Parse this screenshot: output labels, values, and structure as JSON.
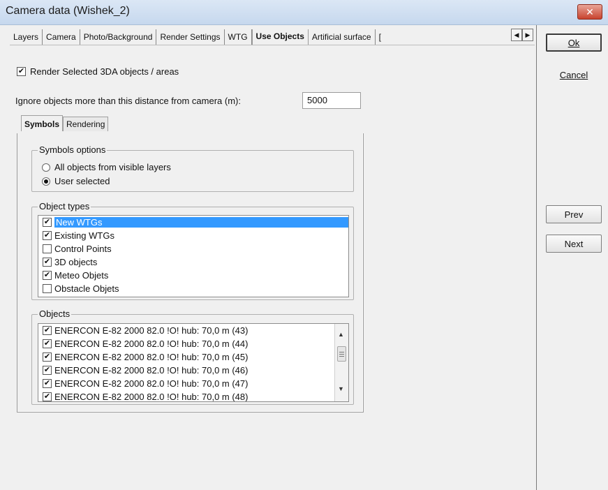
{
  "window": {
    "title": "Camera data  (Wishek_2)",
    "close_glyph": "✕"
  },
  "tabs": [
    {
      "label": "Layers"
    },
    {
      "label": "Camera"
    },
    {
      "label": "Photo/Background"
    },
    {
      "label": "Render Settings"
    },
    {
      "label": "WTG"
    },
    {
      "label": "Use Objects",
      "active": true
    },
    {
      "label": "Artificial surface"
    },
    {
      "label": "["
    }
  ],
  "tab_scroll": {
    "left": "◀",
    "right": "▶"
  },
  "buttons": {
    "ok": "Ok",
    "cancel": "Cancel",
    "prev": "Prev",
    "next": "Next"
  },
  "render_selected": {
    "label": "Render Selected 3DA objects / areas",
    "checked": true
  },
  "distance": {
    "label": "Ignore objects more than this distance from camera (m):",
    "value": "5000"
  },
  "inner_tabs": {
    "symbols": "Symbols",
    "rendering": "Rendering"
  },
  "symbols_options": {
    "title": "Symbols options",
    "option_all": "All objects from visible layers",
    "option_user": "User selected",
    "selected": "user"
  },
  "object_types": {
    "title": "Object types",
    "items": [
      {
        "label": "New WTGs",
        "checked": true,
        "selected": true
      },
      {
        "label": "Existing WTGs",
        "checked": true
      },
      {
        "label": "Control Points",
        "checked": false
      },
      {
        "label": "3D objects",
        "checked": true
      },
      {
        "label": "Meteo Objets",
        "checked": true
      },
      {
        "label": "Obstacle Objets",
        "checked": false
      }
    ]
  },
  "objects": {
    "title": "Objects",
    "items": [
      {
        "label": "ENERCON E-82 2000 82.0 !O! hub: 70,0 m (43)",
        "checked": true
      },
      {
        "label": "ENERCON E-82 2000 82.0 !O! hub: 70,0 m (44)",
        "checked": true
      },
      {
        "label": "ENERCON E-82 2000 82.0 !O! hub: 70,0 m (45)",
        "checked": true
      },
      {
        "label": "ENERCON E-82 2000 82.0 !O! hub: 70,0 m (46)",
        "checked": true
      },
      {
        "label": "ENERCON E-82 2000 82.0 !O! hub: 70,0 m (47)",
        "checked": true
      },
      {
        "label": "ENERCON E-82 2000 82.0 !O! hub: 70,0 m (48)",
        "checked": true
      }
    ],
    "scroll_up": "▲",
    "scroll_down": "▼"
  },
  "check_glyph": "✔",
  "icons": {
    "close": "close-icon",
    "scroll_left": "arrow-left-icon",
    "scroll_right": "arrow-right-icon",
    "list_up": "scroll-up-icon",
    "list_down": "scroll-down-icon"
  },
  "colors": {
    "selection": "#3399ff",
    "titlebar": "#c6d8ee",
    "close": "#c8432e"
  }
}
